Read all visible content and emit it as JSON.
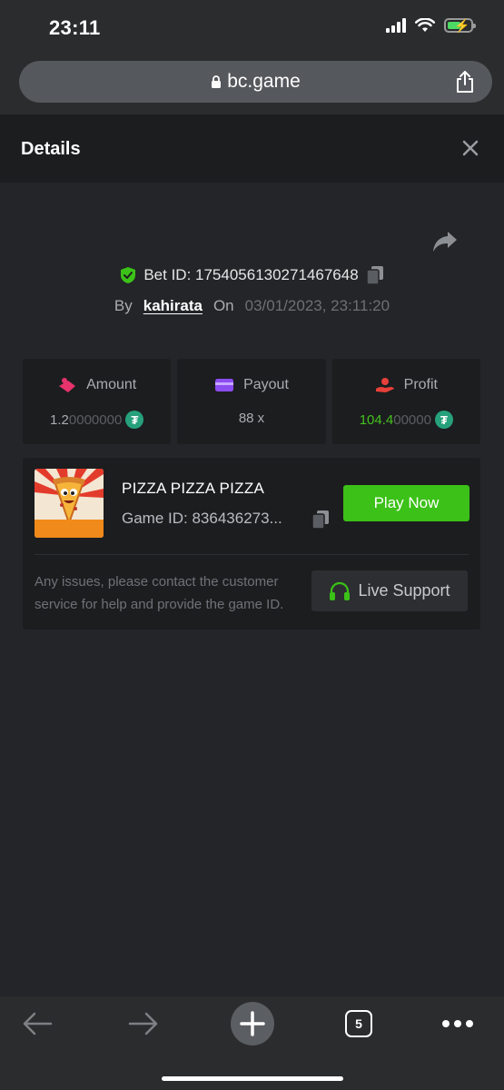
{
  "status": {
    "time": "23:11"
  },
  "browser": {
    "url": "bc.game",
    "tab_count": "5"
  },
  "header": {
    "title": "Details"
  },
  "bet": {
    "bet_id_label": "Bet ID: 1754056130271467648",
    "by_label": "By",
    "username": "kahirata",
    "on_label": "On",
    "datetime": "03/01/2023, 23:11:20"
  },
  "stats": {
    "amount_label": "Amount",
    "amount_main": "1.2",
    "amount_dim": "0000000",
    "payout_label": "Payout",
    "payout_value": "88 x",
    "profit_label": "Profit",
    "profit_main": "104.4",
    "profit_dim": "00000"
  },
  "game": {
    "name": "PIZZA PIZZA PIZZA",
    "game_id": "Game ID: 836436273...",
    "play_label": "Play Now",
    "issue_text": "Any issues, please contact the customer service for help and provide the game ID.",
    "support_label": "Live Support",
    "thumb_text": "PIZZA! PIZZA? PIZZA!"
  },
  "colors": {
    "accent_green": "#3bc117",
    "tether": "#26a17b",
    "amount_icon": "#e8336d",
    "payout_icon": "#8b4cf0",
    "profit_icon": "#e8403a"
  }
}
